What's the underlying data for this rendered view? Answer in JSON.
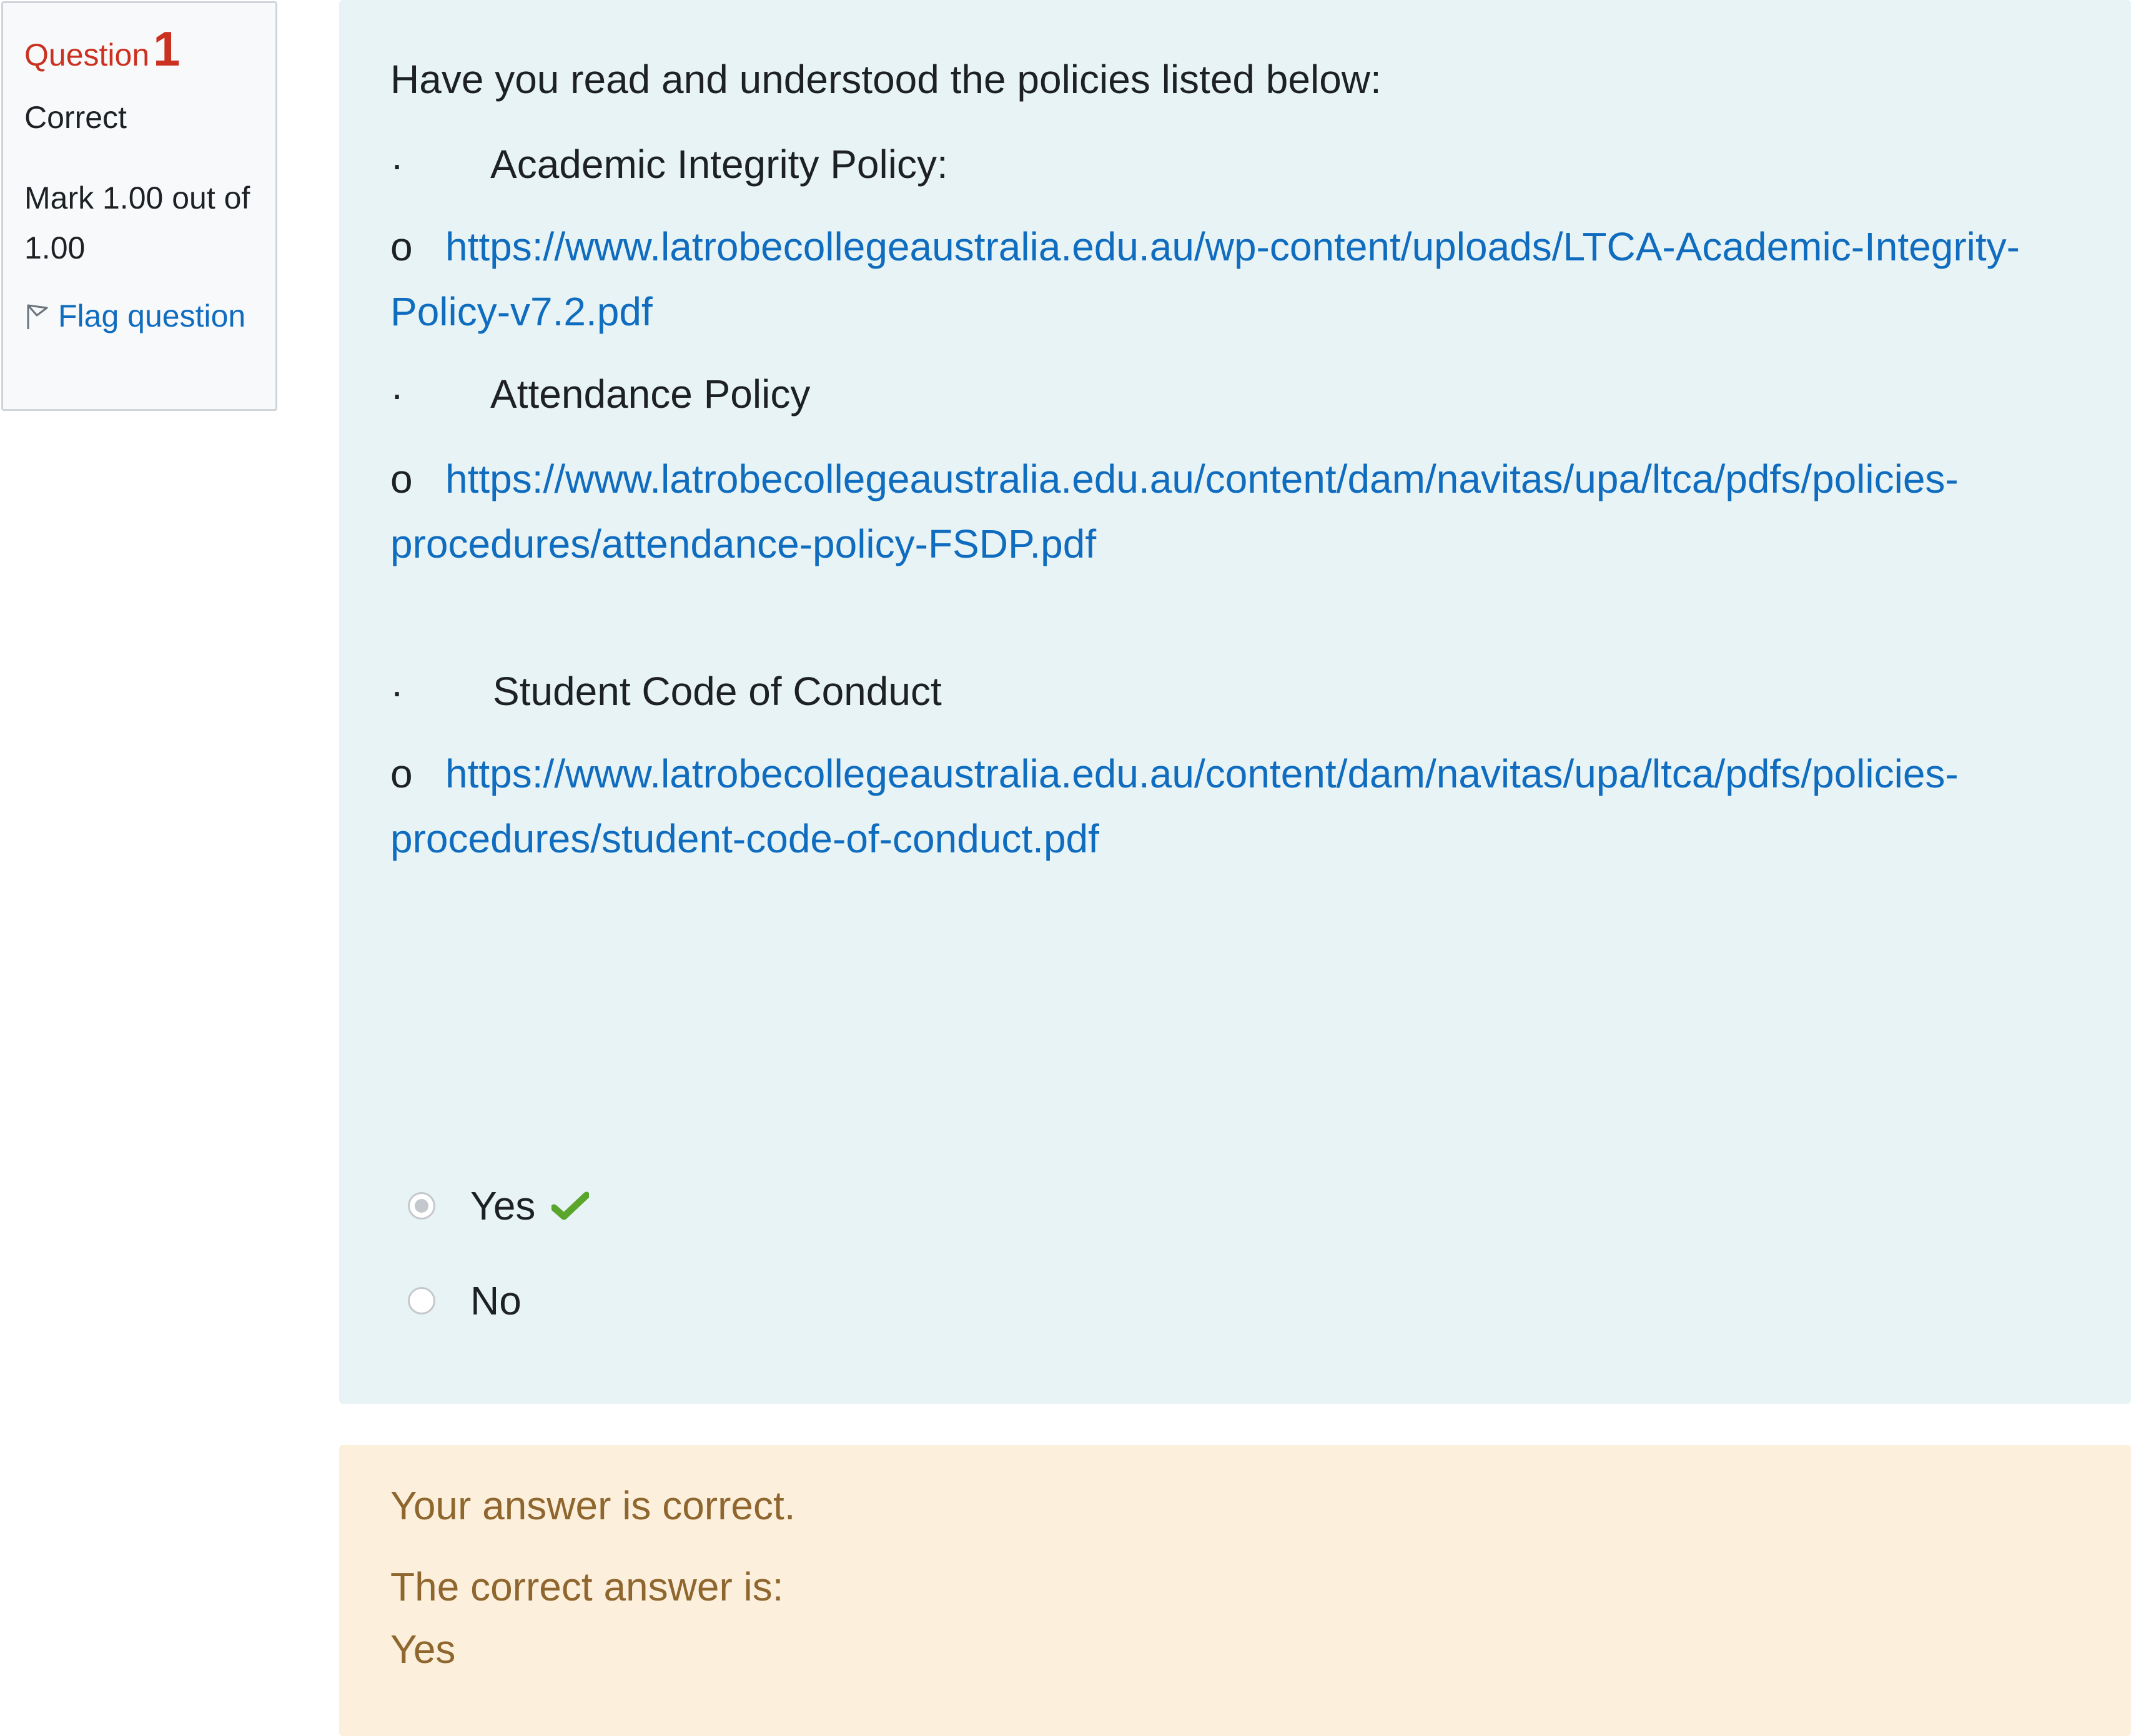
{
  "info": {
    "question_label": "Question",
    "question_number": "1",
    "state": "Correct",
    "grade": "Mark 1.00 out of 1.00",
    "flag_label": "Flag question"
  },
  "question": {
    "prompt": "Have you read and understood the policies listed below:",
    "bullet_char": "·",
    "sub_char": "o",
    "policies": [
      {
        "title": "Academic Integrity Policy:",
        "link_line1": "https://www.latrobecollegeaustralia.edu.au/wp-content/uploads/LTCA-Academic-Integrity-",
        "link_line2": "Policy-v7.2.pdf"
      },
      {
        "title": "Attendance Policy",
        "link_line1": "https://www.latrobecollegeaustralia.edu.au/content/dam/navitas/upa/ltca/pdfs/policies-",
        "link_line2": "procedures/attendance-policy-FSDP.pdf"
      },
      {
        "title": "Student Code of Conduct",
        "link_line1": "https://www.latrobecollegeaustralia.edu.au/content/dam/navitas/upa/ltca/pdfs/policies-",
        "link_line2": "procedures/student-code-of-conduct.pdf"
      }
    ],
    "options": [
      {
        "label": "Yes",
        "selected": true,
        "correct": true
      },
      {
        "label": "No",
        "selected": false,
        "correct": false
      }
    ]
  },
  "feedback": {
    "result": "Your answer is correct.",
    "correct_answer_label": "The correct answer is:",
    "correct_answer": "Yes"
  },
  "colors": {
    "accent_red": "#ca3120",
    "link_blue": "#0f6cbf",
    "formulation_bg": "#e7f3f5",
    "feedback_bg": "#fcefdc",
    "feedback_text": "#8e662e",
    "correct_green": "#5aa52c"
  }
}
